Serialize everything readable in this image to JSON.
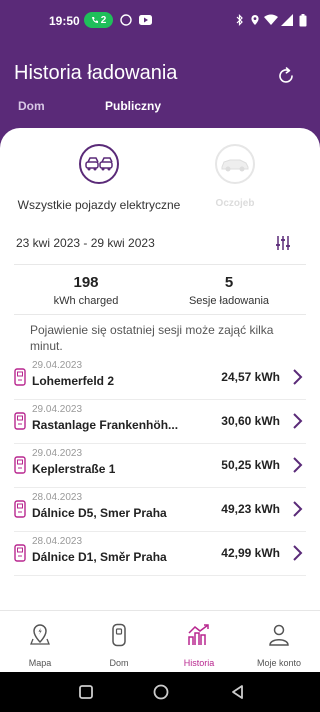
{
  "status_bar": {
    "time": "19:50",
    "notification_count": "2",
    "icons": [
      "bluetooth-icon",
      "location-icon",
      "wifi-icon",
      "signal-icon",
      "battery-icon"
    ],
    "wifi_label": "LTE"
  },
  "header": {
    "title": "Historia ładowania",
    "tabs": [
      {
        "label": "Dom",
        "active": false
      },
      {
        "label": "Publiczny",
        "active": true
      }
    ]
  },
  "vehicles": [
    {
      "label": "Wszystkie pojazdy elektryczne",
      "selected": true
    },
    {
      "label": "Oczojeb",
      "selected": false
    }
  ],
  "date_range": "23 kwi 2023 - 29 kwi 2023",
  "stats": {
    "energy_value": "198",
    "energy_label": "kWh charged",
    "sessions_value": "5",
    "sessions_label": "Sesje ładowania"
  },
  "notice": "Pojawienie się ostatniej sesji może zająć kilka minut.",
  "sessions": [
    {
      "date": "29.04.2023",
      "location": "Lohemerfeld 2",
      "energy": "24,57 kWh"
    },
    {
      "date": "29.04.2023",
      "location": "Rastanlage Frankenhöh...",
      "energy": "30,60 kWh"
    },
    {
      "date": "29.04.2023",
      "location": "Keplerstraße 1",
      "energy": "50,25 kWh"
    },
    {
      "date": "28.04.2023",
      "location": "Dálnice D5, Smer Praha",
      "energy": "49,23 kWh"
    },
    {
      "date": "28.04.2023",
      "location": "Dálnice D1, Směr Praha",
      "energy": "42,99 kWh"
    }
  ],
  "bottom_nav": [
    {
      "label": "Mapa",
      "icon": "map-pin-icon",
      "active": false
    },
    {
      "label": "Dom",
      "icon": "home-charger-icon",
      "active": false
    },
    {
      "label": "Historia",
      "icon": "history-chart-icon",
      "active": true
    },
    {
      "label": "Moje konto",
      "icon": "account-icon",
      "active": false
    }
  ],
  "colors": {
    "brand": "#5a2a78",
    "accent": "#b8278f"
  }
}
